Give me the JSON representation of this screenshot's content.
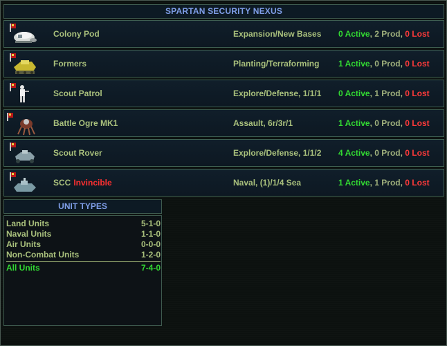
{
  "title": "SPARTAN SECURITY NEXUS",
  "units": [
    {
      "name": "Colony Pod",
      "special": "",
      "role": "Expansion/New Bases",
      "active": "0 Active",
      "prod": "2 Prod",
      "lost": "0 Lost",
      "icon": "colony-pod-icon"
    },
    {
      "name": "Formers",
      "special": "",
      "role": "Planting/Terraforming",
      "active": "1 Active",
      "prod": "0 Prod",
      "lost": "0 Lost",
      "icon": "formers-icon"
    },
    {
      "name": "Scout Patrol",
      "special": "",
      "role": "Explore/Defense, 1/1/1",
      "active": "0 Active",
      "prod": "1 Prod",
      "lost": "0 Lost",
      "icon": "scout-patrol-icon"
    },
    {
      "name": "Battle Ogre MK1",
      "special": "",
      "role": "Assault, 6r/3r/1",
      "active": "1 Active",
      "prod": "0 Prod",
      "lost": "0 Lost",
      "icon": "battle-ogre-icon"
    },
    {
      "name": "Scout Rover",
      "special": "",
      "role": "Explore/Defense, 1/1/2",
      "active": "4 Active",
      "prod": "0 Prod",
      "lost": "0 Lost",
      "icon": "scout-rover-icon"
    },
    {
      "name": "SCC",
      "special": "Invincible",
      "role": "Naval, (1)/1/4 Sea",
      "active": "1 Active",
      "prod": "1 Prod",
      "lost": "0 Lost",
      "icon": "naval-unit-icon"
    }
  ],
  "unit_types": {
    "header": "UNIT TYPES",
    "rows": [
      {
        "label": "Land Units",
        "value": "5-1-0"
      },
      {
        "label": "Naval Units",
        "value": "1-1-0"
      },
      {
        "label": "Air Units",
        "value": "0-0-0"
      },
      {
        "label": "Non-Combat Units",
        "value": "1-2-0"
      }
    ],
    "total": {
      "label": "All Units",
      "value": "7-4-0"
    }
  },
  "colors": {
    "accent_title": "#7f9ee8",
    "active": "#32d832",
    "lost": "#ff3a3a",
    "text": "#a9c07c",
    "border": "#3f6052"
  }
}
